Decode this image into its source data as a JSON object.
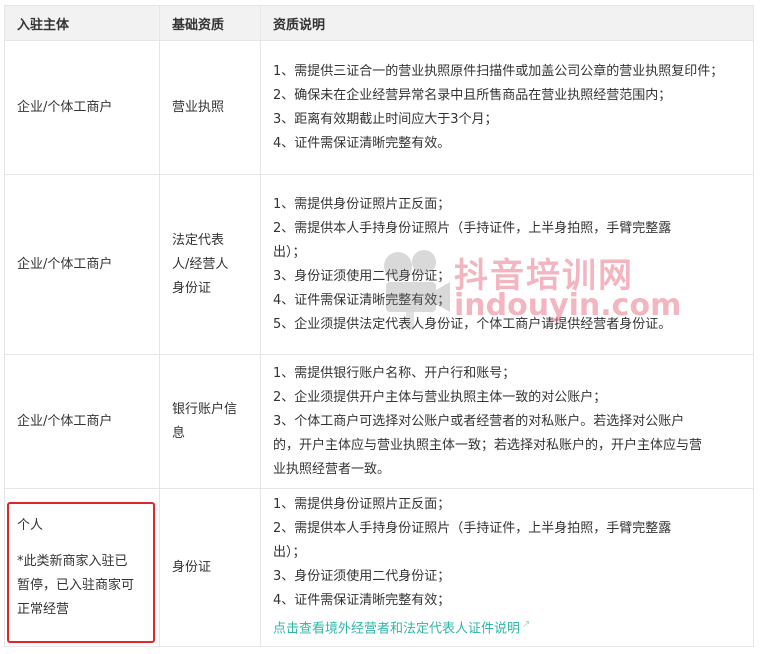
{
  "headers": [
    "入驻主体",
    "基础资质",
    "资质说明"
  ],
  "rows": [
    {
      "subject": "企业/个体工商户",
      "qualification": [
        "营业执照"
      ],
      "lines": [
        "1、需提供三证合一的营业执照原件扫描件或加盖公司公章的营业执照复印件；",
        "2、确保未在企业经营异常名录中且所售商品在营业执照经营范围内；",
        "3、距离有效期截止时间应大于3个月；",
        "4、证件需保证清晰完整有效。"
      ]
    },
    {
      "subject": "企业/个体工商户",
      "qualification": [
        "法定代表",
        "人/经营人",
        "身份证"
      ],
      "lines": [
        "1、需提供身份证照片正反面；",
        "2、需提供本人手持身份证照片（手持证件，上半身拍照，手臂完整露",
        "出）；",
        "3、身份证须使用二代身份证；",
        "4、证件需保证清晰完整有效；",
        "5、企业须提供法定代表人身份证，个体工商户请提供经营者身份证。"
      ]
    },
    {
      "subject": "企业/个体工商户",
      "qualification": [
        "银行账户信",
        "息"
      ],
      "lines": [
        "1、需提供银行账户名称、开户行和账号；",
        "2、企业须提供开户主体与营业执照主体一致的对公账户；",
        "3、个体工商户可选择对公账户或者经营者的对私账户。若选择对公账户",
        "的，开户主体应与营业执照主体一致；若选择对私账户的，开户主体应与营",
        "业执照经营者一致。"
      ]
    },
    {
      "subject": "个人",
      "subject_note": [
        "*此类新商家入驻已",
        "暂停，已入驻商家可",
        "正常经营"
      ],
      "qualification": [
        "身份证"
      ],
      "lines": [
        "1、需提供身份证照片正反面；",
        "2、需提供本人手持身份证照片（手持证件，上半身拍照，手臂完整露",
        "出）；",
        "3、身份证须使用二代身份证；",
        "4、证件需保证清晰完整有效；"
      ],
      "link": "点击查看境外经营者和法定代表人证件说明"
    }
  ],
  "watermark": {
    "text_cn": "抖音培训网",
    "text_en": "indouyin.com"
  },
  "colors": {
    "header_bg": "#f2f2f2",
    "border": "#e6e6e6",
    "link": "#2fb5a9",
    "highlight": "#e02626",
    "watermark": "#ea788c"
  },
  "icons": {
    "link": "external-link-icon",
    "watermark": "film-camera-icon"
  }
}
